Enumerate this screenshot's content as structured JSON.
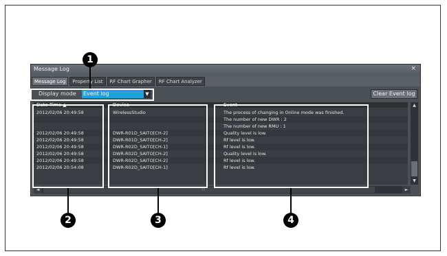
{
  "window": {
    "title": "Message Log",
    "close_glyph": "×"
  },
  "tabs": [
    {
      "label": "Message Log",
      "active": true
    },
    {
      "label": "Property List",
      "active": false
    },
    {
      "label": "RF Chart Grapher",
      "active": false
    },
    {
      "label": "RF Chart Analyzer",
      "active": false
    }
  ],
  "toolbar": {
    "display_mode_label": "Display mode",
    "display_mode_value": "Event log",
    "clear_button": "Clear Event log"
  },
  "table": {
    "headers": {
      "date": "Date Time ▲",
      "device": "Device",
      "event": "Event"
    },
    "rows": [
      {
        "date": "2012/02/06  20:49:58",
        "device": "WirelessStudio",
        "event": "The process of changing in Online mode was finished."
      },
      {
        "date": "",
        "device": "",
        "event": "The number of new DWR : 2"
      },
      {
        "date": "",
        "device": "",
        "event": "The number of new RMU : 1"
      },
      {
        "date": "2012/02/06  20:49:58",
        "device": "DWR-R01D_SAITO[CH-2]",
        "event": "Quality level is low."
      },
      {
        "date": "2012/02/06  20:49:58",
        "device": "DWR-R01D_SAITO[CH-2]",
        "event": "Rf level is low."
      },
      {
        "date": "2012/02/06  20:49:58",
        "device": "DWR-R02D_SAITO[CH-1]",
        "event": "Rf level is low."
      },
      {
        "date": "2012/02/06  20:49:58",
        "device": "DWR-R02D_SAITO[CH-2]",
        "event": "Quality level is low."
      },
      {
        "date": "2012/02/06  20:49:58",
        "device": "DWR-R02D_SAITO[CH-2]",
        "event": "Rf level is low."
      },
      {
        "date": "2012/02/06  20:54:08",
        "device": "DWR-R02D_SAITO[CH-1]",
        "event": "Rf level is low."
      }
    ]
  },
  "scroll": {
    "up": "▲",
    "down": "▼",
    "left": "◄",
    "right": "►",
    "grip": "III"
  },
  "callouts": [
    "1",
    "2",
    "3",
    "4"
  ],
  "colors": {
    "selection_blue": "#1aa3e0",
    "window_gray": "#5b6066"
  }
}
